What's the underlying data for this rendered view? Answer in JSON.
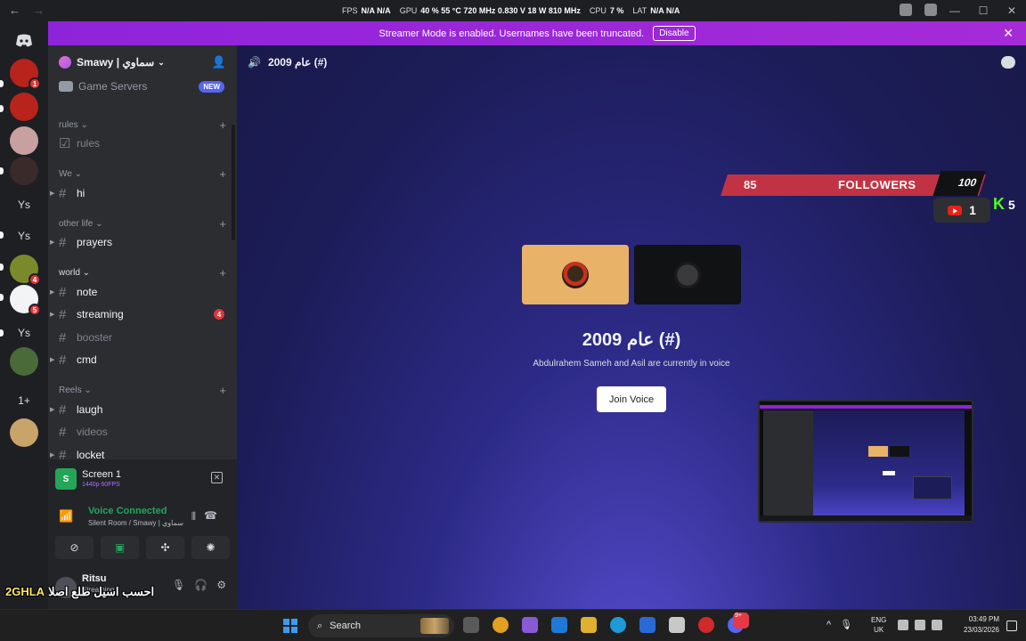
{
  "titlebar": {
    "back": "←",
    "forward": "→",
    "window_title": "Smawy | سماوي",
    "stats": [
      {
        "label": "FPS",
        "value": "N/A  N/A"
      },
      {
        "label": "GPU",
        "value": "40 %  55 °C  720 MHz  0.830 V  18 W  810 MHz"
      },
      {
        "label": "CPU",
        "value": "7 %"
      },
      {
        "label": "LAT",
        "value": "N/A  N/A"
      }
    ],
    "minimize": "—",
    "maximize": "☐",
    "close": "✕"
  },
  "rail": {
    "servers": [
      {
        "label": "",
        "color": "#5865f2",
        "glyph": "◉",
        "badge": ""
      },
      {
        "label": "",
        "color": "#b8231c",
        "glyph": "",
        "badge": "1"
      },
      {
        "label": "",
        "color": "#b8231c",
        "glyph": "",
        "badge": ""
      },
      {
        "label": "",
        "color": "#c9a0a0",
        "glyph": "",
        "badge": ""
      },
      {
        "label": "",
        "color": "#3a2a2a",
        "glyph": "",
        "badge": ""
      },
      {
        "label": "Ys",
        "color": "#1e1f22",
        "glyph": "",
        "badge": ""
      },
      {
        "label": "Ys",
        "color": "#1e1f22",
        "glyph": "",
        "badge": ""
      },
      {
        "label": "",
        "color": "#7a8a2a",
        "glyph": "",
        "badge": "4"
      },
      {
        "label": "",
        "color": "#f2f3f5",
        "glyph": "",
        "badge": "5"
      },
      {
        "label": "Ys",
        "color": "#1e1f22",
        "glyph": "",
        "badge": ""
      },
      {
        "label": "",
        "color": "#4a6a3a",
        "glyph": "",
        "badge": ""
      },
      {
        "label": "1+",
        "color": "#1e1f22",
        "glyph": "",
        "badge": ""
      },
      {
        "label": "",
        "color": "#c9a46a",
        "glyph": "",
        "badge": ""
      }
    ]
  },
  "banner": {
    "text": "Streamer Mode is enabled. Usernames have been truncated.",
    "button": "Disable",
    "close": "✕"
  },
  "sidebar": {
    "guild_name": "Smawy | سماوي",
    "game_servers": "Game Servers",
    "new_badge": "NEW",
    "categories": [
      {
        "name": "rules ⌄",
        "channels": [
          {
            "name": "rules",
            "style": "dim",
            "icon": "☑",
            "mention": ""
          }
        ]
      },
      {
        "name": "We ⌄",
        "channels": [
          {
            "name": "hi",
            "style": "bright",
            "icon": "#",
            "mention": ""
          }
        ]
      },
      {
        "name": "other life ⌄",
        "channels": [
          {
            "name": "prayers",
            "style": "bright",
            "icon": "#",
            "mention": ""
          }
        ]
      },
      {
        "name": "world ⌄",
        "channels": [
          {
            "name": "note",
            "style": "bright",
            "icon": "#",
            "mention": ""
          },
          {
            "name": "streaming",
            "style": "bright",
            "icon": "#",
            "mention": "4"
          },
          {
            "name": "booster",
            "style": "dim",
            "icon": "#",
            "mention": ""
          },
          {
            "name": "cmd",
            "style": "bright",
            "icon": "#",
            "mention": ""
          }
        ]
      },
      {
        "name": "Reels ⌄",
        "channels": [
          {
            "name": "laugh",
            "style": "bright",
            "icon": "#",
            "mention": ""
          },
          {
            "name": "videos",
            "style": "dim",
            "icon": "#",
            "mention": ""
          },
          {
            "name": "locket",
            "style": "bright",
            "icon": "#",
            "mention": ""
          }
        ]
      }
    ]
  },
  "panel": {
    "screen_title": "Screen 1",
    "screen_quality": "1440p 60FPS",
    "voice_status": "Voice Connected",
    "voice_location": "Silent Room / Smawy | سماوي",
    "user_name": "Ritsu",
    "user_status": "Streaming"
  },
  "overlay_text": {
    "tag": "2GHLA",
    "text": "احسب اسيل طلع اصلا"
  },
  "main": {
    "channel_name": "عام 2009 (#)",
    "voice_title": "عام 2009 (#)",
    "voice_sub": "Abdulrahem Sameh and Asil are currently in voice",
    "join_button": "Join Voice"
  },
  "followers_overlay": {
    "count": "85",
    "label": "FOLLOWERS",
    "goal": "100",
    "youtube_count": "1",
    "kick_count": "5"
  },
  "taskbar": {
    "search_placeholder": "Search",
    "lang_top": "ENG",
    "lang_bottom": "UK",
    "time": "03:49 PM",
    "date": "23/03/2026",
    "discord_badge": "9+",
    "apps": [
      {
        "name": "task-view",
        "color": "#5a5a5a"
      },
      {
        "name": "chrome",
        "color": "#e0a020"
      },
      {
        "name": "copilot",
        "color": "#8a5ad6"
      },
      {
        "name": "app-blue",
        "color": "#1e7ad6"
      },
      {
        "name": "explorer",
        "color": "#e0b030"
      },
      {
        "name": "edge",
        "color": "#1e9ad6"
      },
      {
        "name": "outlook",
        "color": "#2a6ad6"
      },
      {
        "name": "store",
        "color": "#c8c8c8"
      },
      {
        "name": "app-red",
        "color": "#d02a2a"
      },
      {
        "name": "discord",
        "color": "#5865f2"
      }
    ]
  }
}
